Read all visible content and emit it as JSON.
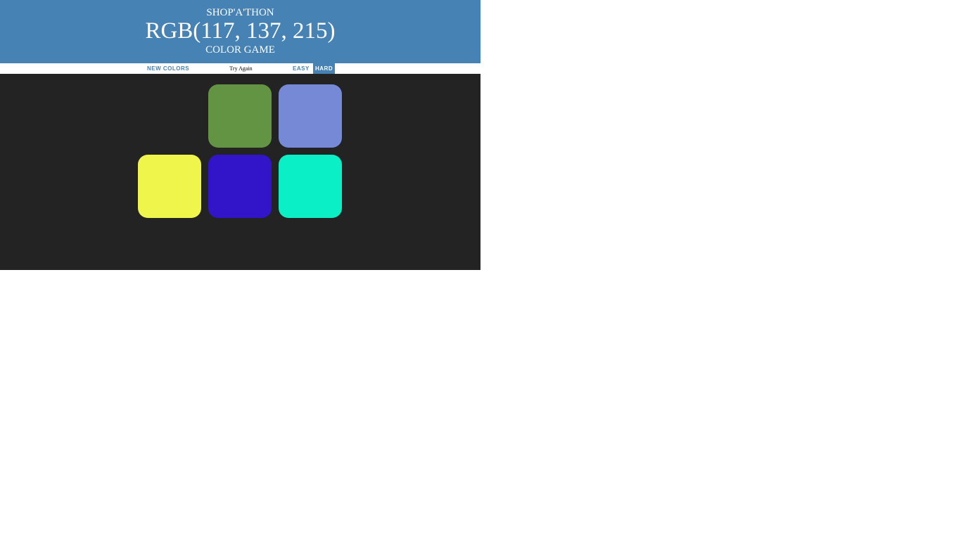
{
  "header": {
    "line1": "SHOP'A'THON",
    "rgb_display": "RGB(117, 137, 215)",
    "line3": "COLOR GAME"
  },
  "controls": {
    "new_colors_label": "NEW COLORS",
    "message": "Try Again",
    "easy_label": "EASY",
    "hard_label": "HARD",
    "selected_mode": "HARD"
  },
  "squares": [
    {
      "color": "#232323",
      "hidden": true
    },
    {
      "color": "#629443",
      "hidden": false
    },
    {
      "color": "#7589d7",
      "hidden": false
    },
    {
      "color": "#f0f54b",
      "hidden": false
    },
    {
      "color": "#3315c9",
      "hidden": false
    },
    {
      "color": "#0aefc6",
      "hidden": false
    }
  ],
  "colors": {
    "header_bg": "#4682b4",
    "body_bg": "#232323",
    "accent": "#4682b4"
  }
}
